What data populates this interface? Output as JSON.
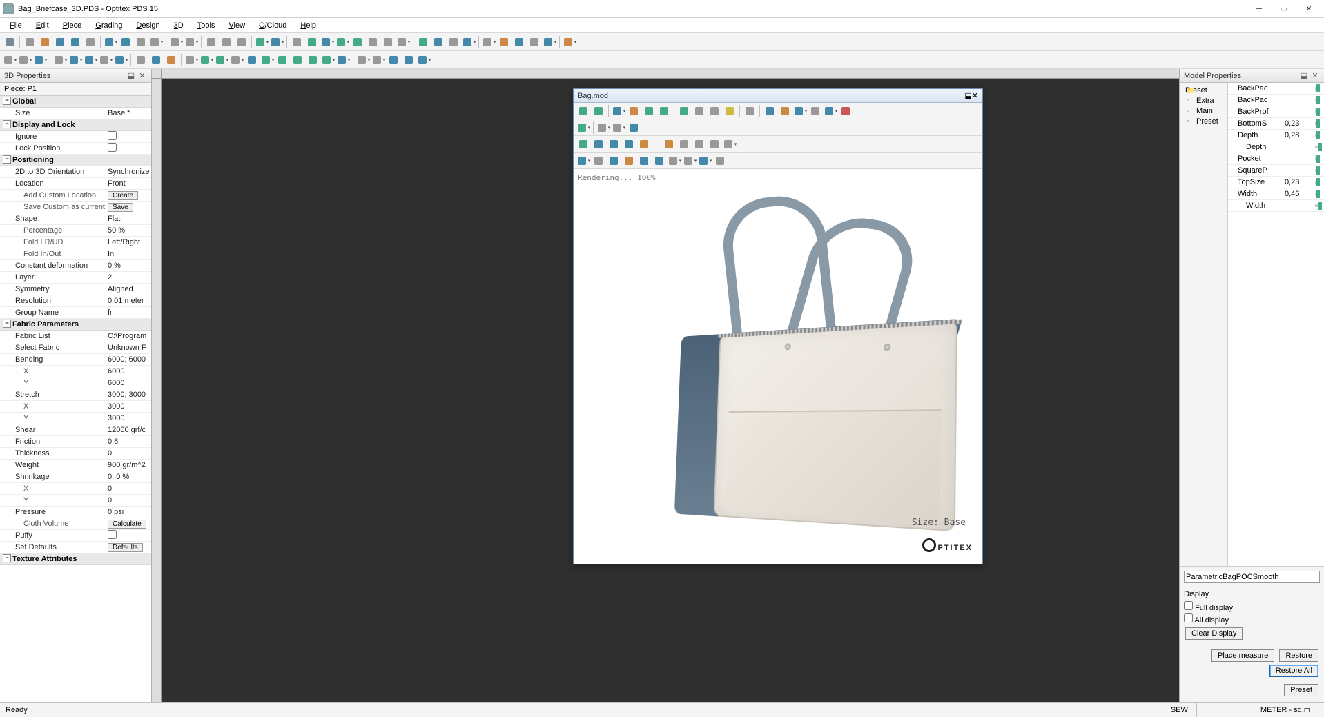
{
  "title": "Bag_Briefcase_3D.PDS - Optitex PDS 15",
  "menus": [
    "File",
    "Edit",
    "Piece",
    "Grading",
    "Design",
    "3D",
    "Tools",
    "View",
    "O/Cloud",
    "Help"
  ],
  "left_panel": {
    "title": "3D Properties",
    "piece": "Piece: P1",
    "groups": [
      {
        "name": "Global",
        "rows": [
          [
            "Size",
            "Base *"
          ]
        ]
      },
      {
        "name": "Display and Lock",
        "rows": [
          [
            "Ignore",
            "[cb]"
          ],
          [
            "Lock Position",
            "[cb]"
          ]
        ]
      },
      {
        "name": "Positioning",
        "rows": [
          [
            "2D to 3D Orientation",
            "Synchronize"
          ],
          [
            "Location",
            "Front"
          ],
          [
            "Add Custom Location",
            "[btn:Create]",
            true
          ],
          [
            "Save Custom as current",
            "[btn:Save]",
            true
          ],
          [
            "Shape",
            "Flat"
          ],
          [
            "Percentage",
            "50 %",
            true
          ],
          [
            "Fold LR/UD",
            "Left/Right",
            true
          ],
          [
            "Fold In/Out",
            "In",
            true
          ],
          [
            "Constant deformation",
            "0 %"
          ],
          [
            "Layer",
            "2"
          ],
          [
            "Symmetry",
            "Aligned"
          ],
          [
            "Resolution",
            "0.01 meter"
          ],
          [
            "Group Name",
            "fr"
          ]
        ]
      },
      {
        "name": "Fabric Parameters",
        "rows": [
          [
            "Fabric List",
            "C:\\Program"
          ],
          [
            "Select Fabric",
            "Unknown F"
          ],
          [
            "Bending",
            "6000; 6000"
          ],
          [
            "X",
            "6000",
            true
          ],
          [
            "Y",
            "6000",
            true
          ],
          [
            "Stretch",
            "3000; 3000"
          ],
          [
            "X",
            "3000",
            true
          ],
          [
            "Y",
            "3000",
            true
          ],
          [
            "Shear",
            "12000 grf/c"
          ],
          [
            "Friction",
            "0.6"
          ],
          [
            "Thickness",
            "0"
          ],
          [
            "Weight",
            "900 gr/m^2"
          ],
          [
            "Shrinkage",
            "0; 0 %"
          ],
          [
            "X",
            "0",
            true
          ],
          [
            "Y",
            "0",
            true
          ],
          [
            "Pressure",
            "0 psi"
          ],
          [
            "Cloth Volume",
            "[btn:Calculate]",
            true
          ],
          [
            "Puffy",
            "[cb]"
          ],
          [
            "Set Defaults",
            "[btn:Defaults]"
          ]
        ]
      },
      {
        "name": "Texture Attributes",
        "rows": []
      }
    ]
  },
  "win3d": {
    "title": "Bag.mod",
    "render_status": "Rendering... 100%",
    "size_label": "Size: Base",
    "logo": "PTITEX"
  },
  "right_panel": {
    "title": "Model Properties",
    "presets": [
      "Preset",
      "Extra",
      "Main",
      "Preset"
    ],
    "params": [
      {
        "k": "BackPac",
        "v": "",
        "pos": 10
      },
      {
        "k": "BackPac",
        "v": "",
        "pos": 10
      },
      {
        "k": "BackProf",
        "v": "",
        "pos": 10
      },
      {
        "k": "BottomS",
        "v": "0,23",
        "pos": 10
      },
      {
        "k": "Depth",
        "v": "0,28",
        "pos": 10
      },
      {
        "k": "Depth",
        "v": "",
        "pos": 50,
        "ind": true
      },
      {
        "k": "Pocket",
        "v": "",
        "pos": 10
      },
      {
        "k": "SquareP",
        "v": "",
        "pos": 10
      },
      {
        "k": "TopSize",
        "v": "0,23",
        "pos": 10
      },
      {
        "k": "Width",
        "v": "0,46",
        "pos": 10
      },
      {
        "k": "Width",
        "v": "",
        "pos": 50,
        "ind": true
      }
    ],
    "textbox": "ParametricBagPOCSmooth",
    "display_label": "Display",
    "cb_full": "Full display",
    "cb_all": "All display",
    "btn_clear": "Clear Display",
    "btn_place": "Place measure",
    "btn_restore": "Restore",
    "btn_restore_all": "Restore All",
    "btn_preset": "Preset"
  },
  "status": {
    "ready": "Ready",
    "sew": "SEW",
    "unit": "METER - sq.m"
  }
}
